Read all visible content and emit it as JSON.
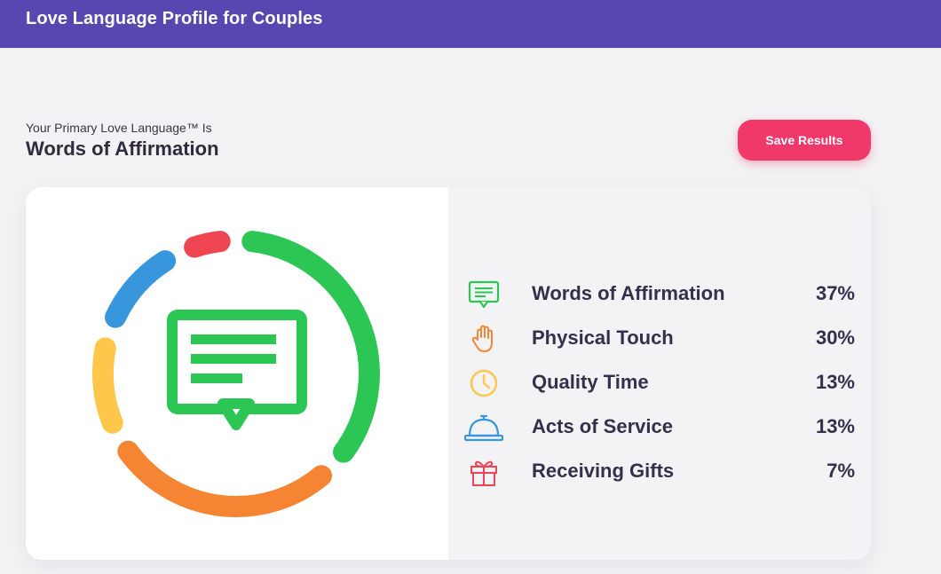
{
  "header": {
    "title": "Love Language Profile for Couples"
  },
  "primary": {
    "intro": "Your Primary Love Language™ Is",
    "value": "Words of Affirmation"
  },
  "actions": {
    "save_label": "Save Results"
  },
  "chart_data": {
    "type": "pie",
    "style": "donut-segments",
    "center_icon": "speech-bubble-icon",
    "series": [
      {
        "name": "Words of Affirmation",
        "value": 37,
        "display": "37%",
        "color": "#2bc653",
        "icon": "speech-bubble-icon"
      },
      {
        "name": "Physical Touch",
        "value": 30,
        "display": "30%",
        "color": "#f58533",
        "icon": "hand-icon"
      },
      {
        "name": "Quality Time",
        "value": 13,
        "display": "13%",
        "color": "#fec64b",
        "icon": "clock-icon"
      },
      {
        "name": "Acts of Service",
        "value": 13,
        "display": "13%",
        "color": "#3896dd",
        "icon": "service-bell-icon"
      },
      {
        "name": "Receiving Gifts",
        "value": 7,
        "display": "7%",
        "color": "#ef4452",
        "icon": "gift-icon"
      }
    ]
  }
}
